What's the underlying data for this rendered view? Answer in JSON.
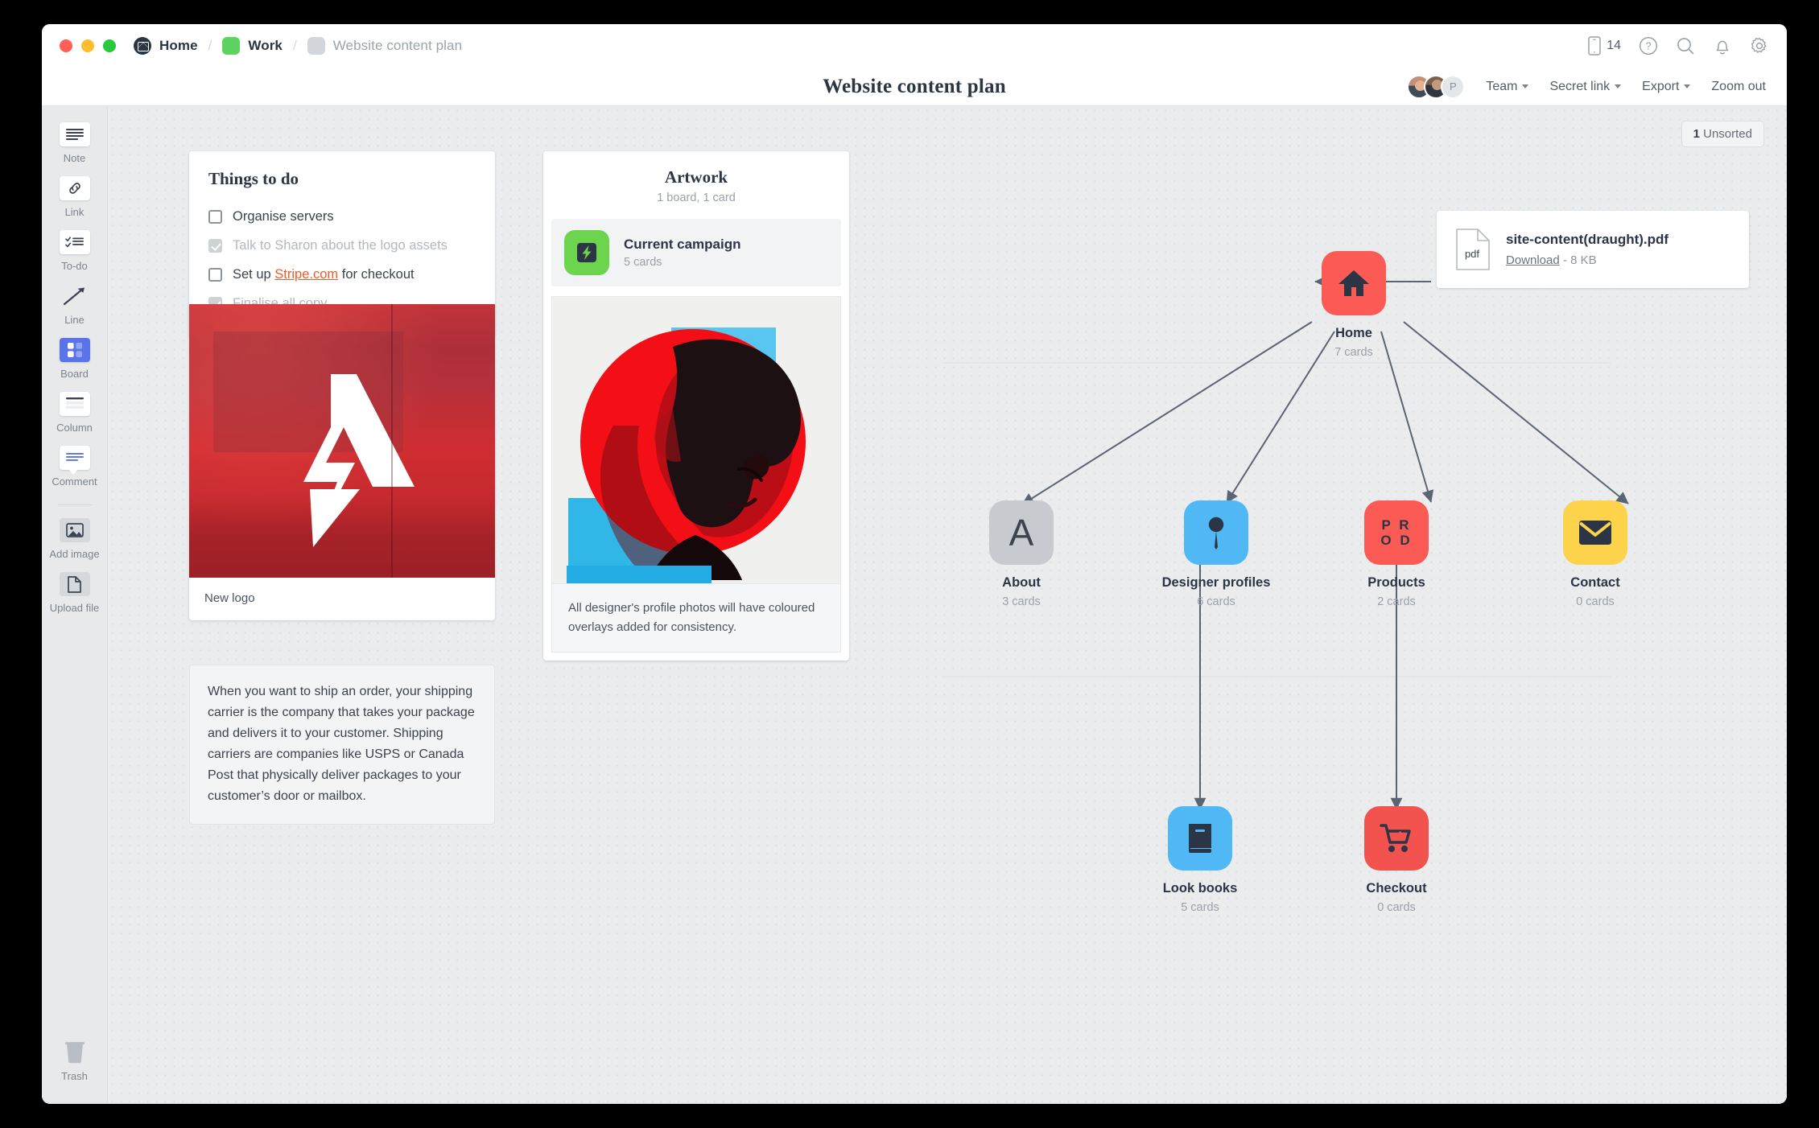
{
  "window": {
    "traffic_lights": [
      "close",
      "minimize",
      "zoom"
    ],
    "breadcrumb": [
      {
        "label": "Home",
        "icon": "milanote-logo-icon"
      },
      {
        "label": "Work",
        "icon": "green-board-icon"
      },
      {
        "label": "Website content plan",
        "icon": "grey-board-icon"
      }
    ],
    "separator": "/",
    "toolbar_right": {
      "device_count": "14",
      "icons": [
        "mobile-icon",
        "help-icon",
        "search-icon",
        "notifications-icon",
        "settings-icon"
      ]
    }
  },
  "header": {
    "title": "Website content plan",
    "avatar_initial": "P",
    "buttons": [
      {
        "label": "Team",
        "caret": true
      },
      {
        "label": "Secret link",
        "caret": true
      },
      {
        "label": "Export",
        "caret": true
      },
      {
        "label": "Zoom out",
        "caret": false
      }
    ]
  },
  "toolbar": {
    "tools": [
      {
        "label": "Note",
        "icon": "note-icon"
      },
      {
        "label": "Link",
        "icon": "link-icon"
      },
      {
        "label": "To-do",
        "icon": "todo-icon"
      },
      {
        "label": "Line",
        "icon": "line-icon"
      },
      {
        "label": "Board",
        "icon": "board-icon"
      },
      {
        "label": "Column",
        "icon": "column-icon"
      },
      {
        "label": "Comment",
        "icon": "comment-icon"
      }
    ],
    "uploads": [
      {
        "label": "Add image",
        "icon": "image-icon"
      },
      {
        "label": "Upload file",
        "icon": "file-icon"
      }
    ],
    "trash": {
      "label": "Trash",
      "icon": "trash-icon"
    }
  },
  "canvas": {
    "unsorted_badge": {
      "count": "1",
      "label": "Unsorted"
    }
  },
  "todo_card": {
    "title": "Things to do",
    "items": [
      {
        "text": "Organise servers",
        "done": false
      },
      {
        "text": "Talk to Sharon about the logo assets",
        "done": true
      },
      {
        "text": "Set up ",
        "link": "Stripe.com",
        "text_after": " for checkout",
        "done": false
      },
      {
        "text": "Finalise all copy",
        "done": true
      }
    ]
  },
  "logo_card": {
    "caption": "New logo",
    "image_alt": "red-painted-wall-with-white-lightning-a-logo"
  },
  "note_card": {
    "text": "When you want to ship an order, your shipping carrier is the company that takes your package and delivers it to your customer. Shipping carriers are companies like USPS or Canada Post that physically deliver packages to your customer’s door or mailbox."
  },
  "artwork_card": {
    "title": "Artwork",
    "subtitle": "1 board, 1 card",
    "row": {
      "title": "Current campaign",
      "subtitle": "5 cards",
      "icon": "lightning-board-icon"
    },
    "photo_alt": "duotone-red-and-blue-portrait-of-woman-in-profile",
    "caption": "All designer's profile photos will have coloured overlays added for consistency."
  },
  "pdf_card": {
    "icon_label": "pdf",
    "filename": "site-content(draught).pdf",
    "download_label": "Download",
    "separator": "-",
    "filesize": "8 KB"
  },
  "sitemap": {
    "nodes": [
      {
        "id": "home",
        "name": "Home",
        "cards": "7 cards",
        "icon": "house-icon",
        "color": "#fb5a55",
        "glyph_color": "#2c3545"
      },
      {
        "id": "about",
        "name": "About",
        "cards": "3 cards",
        "icon": "letter-a-icon",
        "color": "#c7cace",
        "glyph_color": "#3d4450"
      },
      {
        "id": "designer-profiles",
        "name": "Designer profiles",
        "cards": "6 cards",
        "icon": "pin-icon",
        "color": "#4fb8f5",
        "glyph_color": "#2c3545"
      },
      {
        "id": "products",
        "name": "Products",
        "cards": "2 cards",
        "icon": "prod-text-icon",
        "color": "#fb5a55",
        "glyph_color": "#2c3545",
        "glyph_text": [
          "P R",
          "O D"
        ]
      },
      {
        "id": "contact",
        "name": "Contact",
        "cards": "0 cards",
        "icon": "envelope-icon",
        "color": "#fcd34b",
        "glyph_color": "#2c3545"
      },
      {
        "id": "look-books",
        "name": "Look books",
        "cards": "5 cards",
        "icon": "book-icon",
        "color": "#4fb8f5",
        "glyph_color": "#2c3545"
      },
      {
        "id": "checkout",
        "name": "Checkout",
        "cards": "0 cards",
        "icon": "shopping-cart-icon",
        "color": "#f3534f",
        "glyph_color": "#2c3545"
      }
    ],
    "edges": [
      {
        "from": "home",
        "to": "about"
      },
      {
        "from": "home",
        "to": "designer-profiles"
      },
      {
        "from": "home",
        "to": "products"
      },
      {
        "from": "home",
        "to": "contact"
      },
      {
        "from": "designer-profiles",
        "to": "look-books"
      },
      {
        "from": "products",
        "to": "checkout"
      },
      {
        "from": "pdf_card",
        "to": "home"
      }
    ]
  }
}
